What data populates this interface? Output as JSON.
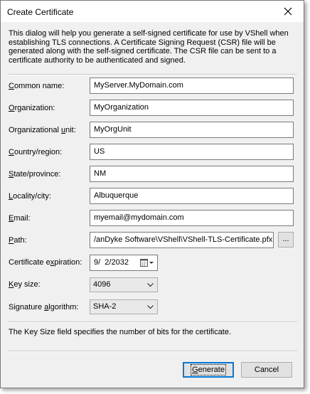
{
  "window": {
    "title": "Create Certificate"
  },
  "intro": "This dialog will help you generate a self-signed certificate for use by VShell when establishing TLS connections.  A Certificate Signing Request (CSR) file will be generated along with the self-signed certificate.  The CSR file can be sent to a certificate authority to be authenticated and signed.",
  "fields": {
    "common_name": {
      "pre": "",
      "key": "C",
      "post": "ommon name:",
      "value": "MyServer.MyDomain.com"
    },
    "organization": {
      "pre": "",
      "key": "O",
      "post": "rganization:",
      "value": "MyOrganization"
    },
    "org_unit": {
      "pre": "Organizational ",
      "key": "u",
      "post": "nit:",
      "value": "MyOrgUnit"
    },
    "country": {
      "pre": "",
      "key": "C",
      "post": "ountry/region:",
      "value": "US"
    },
    "state": {
      "pre": "",
      "key": "S",
      "post": "tate/province:",
      "value": "NM"
    },
    "locality": {
      "pre": "",
      "key": "L",
      "post": "ocality/city:",
      "value": "Albuquerque"
    },
    "email": {
      "pre": "",
      "key": "E",
      "post": "mail:",
      "value": "myemail@mydomain.com"
    },
    "path": {
      "pre": "",
      "key": "P",
      "post": "ath:",
      "value": "/anDyke Software\\VShell\\VShell-TLS-Certificate.pfx"
    }
  },
  "browse_label": "...",
  "expiration": {
    "pre": "Certificate e",
    "key": "x",
    "post": "piration:",
    "value": "9/  2/2032"
  },
  "key_size": {
    "pre": "",
    "key": "K",
    "post": "ey size:",
    "value": "4096"
  },
  "signature": {
    "pre": "Signature ",
    "key": "a",
    "post": "lgorithm:",
    "value": "SHA-2"
  },
  "hint": "The Key Size field specifies the number of bits for the certificate.",
  "buttons": {
    "generate": {
      "key": "G",
      "post": "enerate"
    },
    "cancel": "Cancel"
  }
}
